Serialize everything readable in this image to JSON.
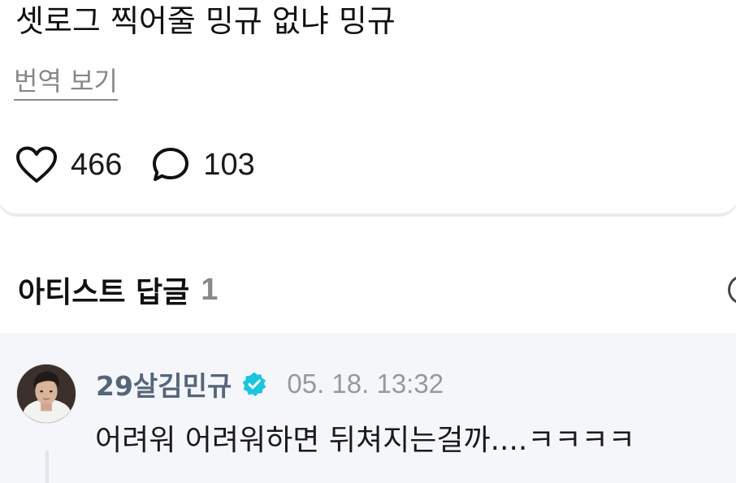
{
  "post": {
    "text": "셋로그 찍어줄 밍규 없냐 밍규",
    "translate_label": "번역 보기",
    "like_count": "466",
    "comment_count": "103"
  },
  "artist_replies": {
    "title": "아티스트 답글",
    "count": "1"
  },
  "reply": {
    "author": "29살김민규",
    "time": "05. 18. 13:32",
    "text": "어려워 어려워하면 뒤쳐지는걸까....ㅋㅋㅋㅋ"
  },
  "icons": {
    "like": "heart-icon",
    "comment": "speech-bubble-icon",
    "verified": "verified-badge-icon",
    "more": "more-icon"
  },
  "colors": {
    "verified": "#1bc5dd",
    "author": "#56657a",
    "muted": "#999999",
    "reply_background": "#f4f6f9"
  }
}
